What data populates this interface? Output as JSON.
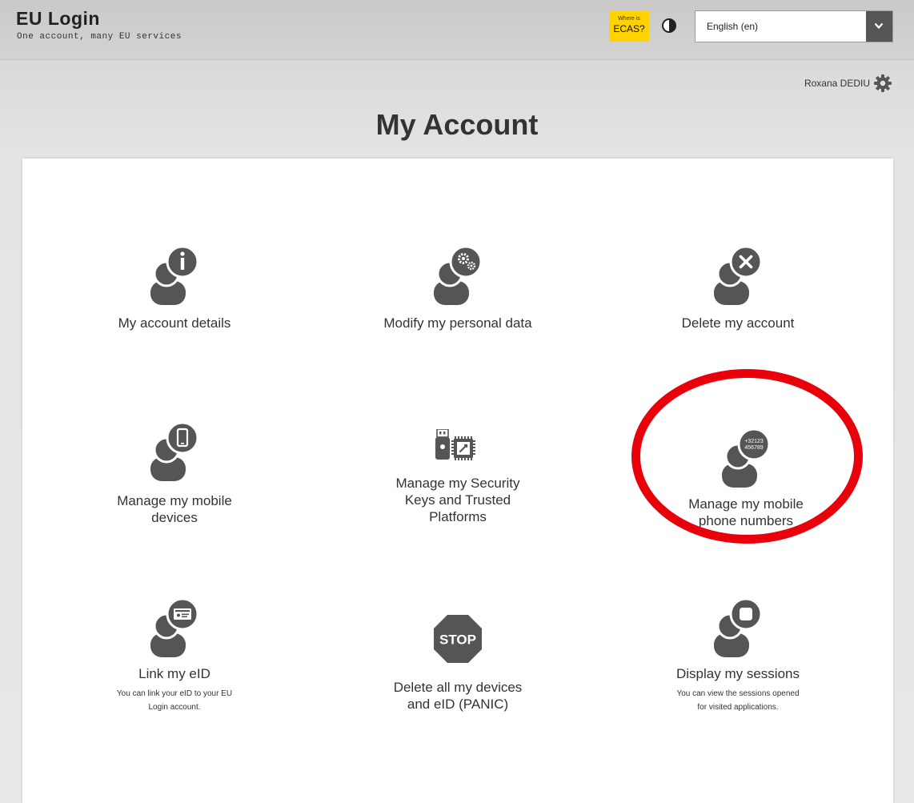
{
  "header": {
    "brand_title": "EU Login",
    "brand_tagline": "One account, many EU services",
    "ecas_small": "Where is",
    "ecas_big": "ECAS?",
    "language_value": "English (en)"
  },
  "user": {
    "name": "Roxana DEDIU"
  },
  "page": {
    "title": "My Account"
  },
  "tiles": [
    {
      "id": "account-details",
      "icon": "user-info-icon",
      "label": "My account details"
    },
    {
      "id": "modify-personal-data",
      "icon": "user-settings-icon",
      "label": "Modify my personal data"
    },
    {
      "id": "delete-account",
      "icon": "user-delete-icon",
      "label": "Delete my account"
    },
    {
      "id": "mobile-devices",
      "icon": "user-mobile-icon",
      "label_line1": "Manage my mobile",
      "label_line2": "devices"
    },
    {
      "id": "security-keys",
      "icon": "security-key-chip-icon",
      "label_line1": "Manage my Security",
      "label_line2": "Keys and Trusted",
      "label_line3": "Platforms"
    },
    {
      "id": "mobile-phone-numbers",
      "icon": "user-phone-number-icon",
      "label_line1": "Manage my mobile",
      "label_line2": "phone numbers",
      "number_line1": "+32123",
      "number_line2": "456789"
    },
    {
      "id": "link-eid",
      "icon": "user-id-card-icon",
      "label": "Link my eID",
      "desc_line1": "You can link your eID to your EU",
      "desc_line2": "Login account."
    },
    {
      "id": "panic",
      "icon": "stop-sign-icon",
      "label_line1": "Delete all my devices",
      "label_line2": "and eID (PANIC)",
      "stop_text": "STOP"
    },
    {
      "id": "sessions",
      "icon": "user-sessions-icon",
      "label": "Display my sessions",
      "desc_line1": "You can view the sessions opened",
      "desc_line2": "for visited applications."
    }
  ],
  "colors": {
    "ecas_yellow": "#ffd200",
    "highlight_red": "#e8000b",
    "icon_gray": "#555555"
  }
}
